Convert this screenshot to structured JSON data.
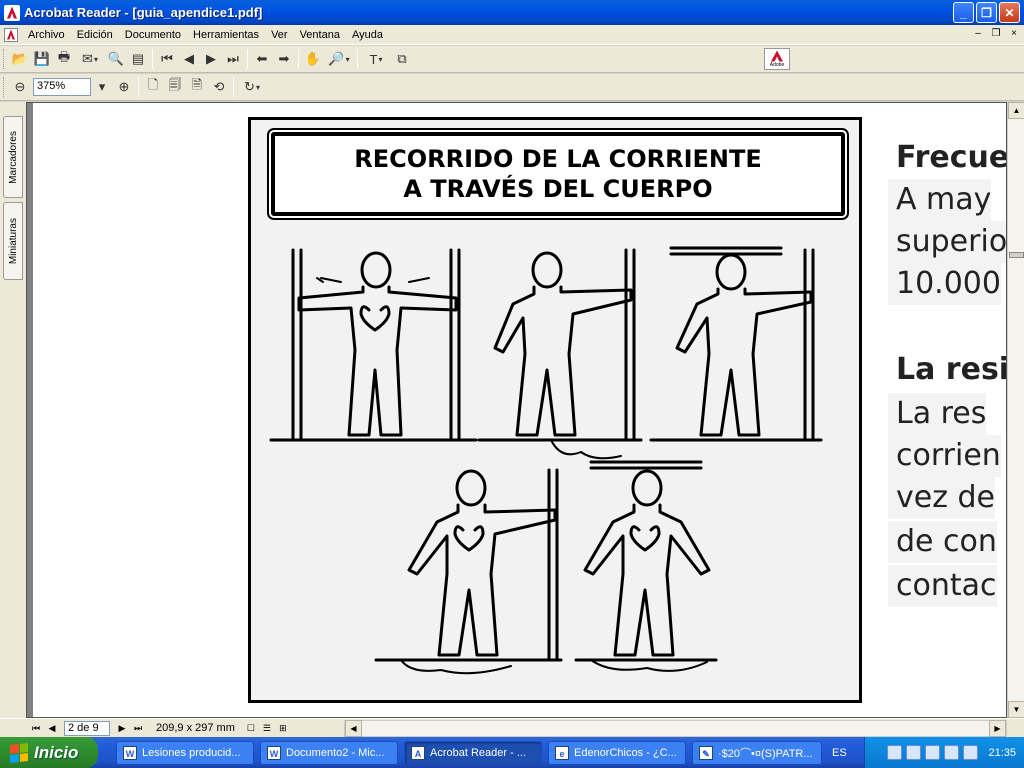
{
  "window": {
    "title": "Acrobat Reader - [guia_apendice1.pdf]",
    "minimize": "_",
    "maximize": "❐",
    "close": "✕"
  },
  "menu": [
    "Archivo",
    "Edición",
    "Documento",
    "Herramientas",
    "Ver",
    "Ventana",
    "Ayuda"
  ],
  "mdi": {
    "minimize": "–",
    "restore": "❐",
    "close": "×"
  },
  "toolbar": {
    "zoom_value": "375%",
    "adobe_logo_text": "Adobe"
  },
  "side_tabs": {
    "bookmarks": "Marcadores",
    "thumbnails": "Miniaturas"
  },
  "document": {
    "figure_title_line1": "RECORRIDO DE LA CORRIENTE",
    "figure_title_line2": "A TRAVÉS DEL CUERPO",
    "text_lines": [
      {
        "text": "Frecue",
        "bold": true
      },
      {
        "text": "A   may",
        "bold": false
      },
      {
        "text": "superio",
        "bold": false
      },
      {
        "text": "10.000",
        "bold": false
      },
      {
        "text": "La resi",
        "bold": true
      },
      {
        "text": "La   res",
        "bold": false
      },
      {
        "text": "corrien",
        "bold": false
      },
      {
        "text": "vez de",
        "bold": false
      },
      {
        "text": "de con",
        "bold": false
      },
      {
        "text": "contac",
        "bold": false
      }
    ]
  },
  "statusbar": {
    "page": "2 de 9",
    "page_size": "209,9 x 297  mm"
  },
  "taskbar": {
    "start": "Inicio",
    "tasks": [
      {
        "label": "Lesiones producid...",
        "icon": "W",
        "active": false
      },
      {
        "label": "Documento2 - Mic...",
        "icon": "W",
        "active": false
      },
      {
        "label": "Acrobat Reader - ...",
        "icon": "A",
        "active": true
      },
      {
        "label": "EdenorChicos - ¿C...",
        "icon": "e",
        "active": false
      },
      {
        "label": "·$20⌒•¤(S)PATR...",
        "icon": "✎",
        "active": false
      }
    ],
    "language": "ES",
    "clock": "21:35"
  }
}
